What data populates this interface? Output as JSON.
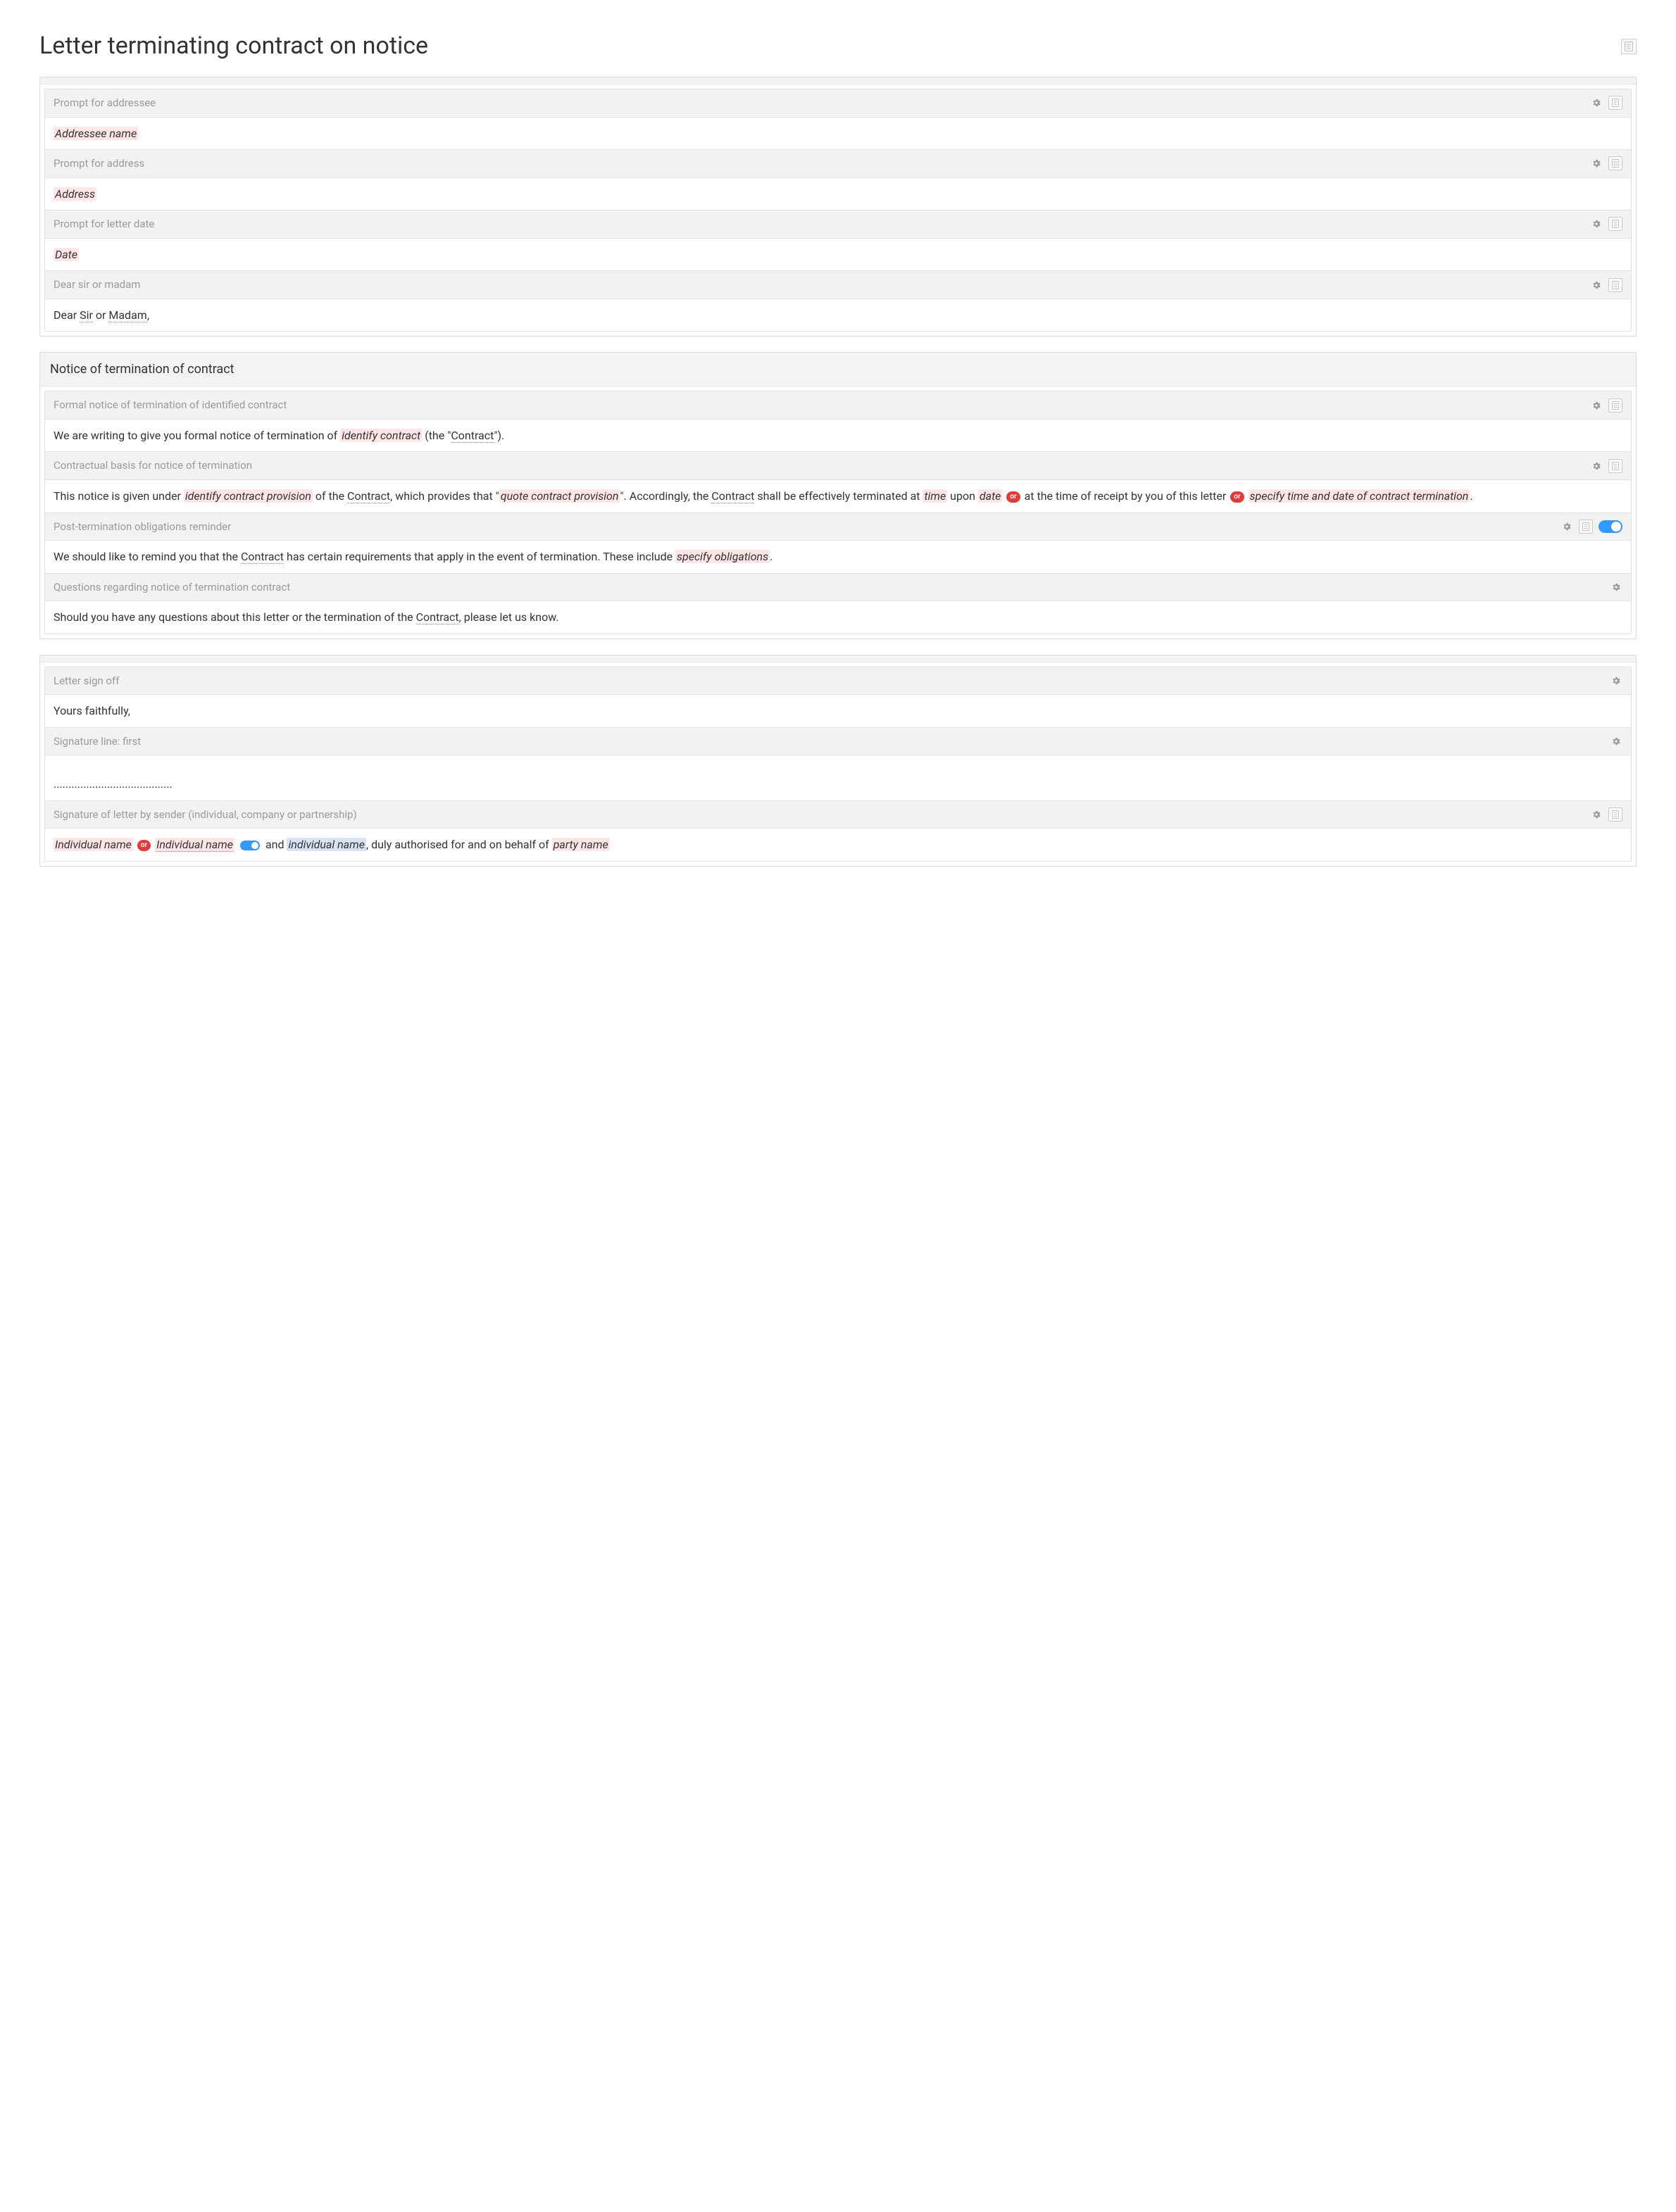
{
  "title": "Letter terminating contract on notice",
  "card1": {
    "b1": {
      "label": "Prompt for addressee",
      "body_fill": "Addressee name"
    },
    "b2": {
      "label": "Prompt for address",
      "body_fill": "Address"
    },
    "b3": {
      "label": "Prompt for letter date",
      "body_fill": "Date"
    },
    "b4": {
      "label": "Dear sir or madam",
      "pre1": "Dear ",
      "sir": "Sir",
      "or": " or ",
      "madam": "Madam",
      "post": ","
    }
  },
  "card2": {
    "heading": "Notice of termination of contract",
    "b1": {
      "label": "Formal notice of termination of identified contract",
      "t1": "We are writing to give you formal notice of termination of ",
      "fill1": "identify contract",
      "t2": " (the \"",
      "contract": "Contract",
      "t3": "\")."
    },
    "b2": {
      "label": "Contractual basis for notice of termination",
      "t1": "This notice is given under ",
      "fill1": "identify contract provision",
      "t2": " of the ",
      "contract1": "Contract",
      "t3": ", which provides that \"",
      "fill2": "quote contract provision",
      "t4": "\". Accordingly, the ",
      "contract2": "Contract",
      "t5": " shall be effectively terminated at ",
      "fill3": "time",
      "t6": " upon ",
      "fill4": "date",
      "or1": "or",
      "t7": " at the time of receipt by you of this letter ",
      "or2": "or",
      "fill5": "specify time and date of contract termination",
      "t8": "."
    },
    "b3": {
      "label": "Post-termination obligations reminder",
      "t1": "We should like to remind you that the ",
      "contract": "Contract",
      "t2": " has certain requirements that apply in the event of termination. These include ",
      "fill1": "specify obligations",
      "t3": "."
    },
    "b4": {
      "label": "Questions regarding notice of termination contract",
      "t1": "Should you have any questions about this letter or the termination of the ",
      "contract": "Contract",
      "t2": ", please let us know."
    }
  },
  "card3": {
    "b1": {
      "label": "Letter sign off",
      "body": "Yours faithfully,"
    },
    "b2": {
      "label": "Signature line: first",
      "dots": "........................................"
    },
    "b3": {
      "label": "Signature of letter by sender (individual, company or partnership)",
      "fill1": "Individual name",
      "or1": "or",
      "fill2": "Individual name",
      "t1": " and ",
      "fill3": "individual name",
      "t2": ", duly authorised for and on behalf of ",
      "fill4": "party name"
    }
  }
}
